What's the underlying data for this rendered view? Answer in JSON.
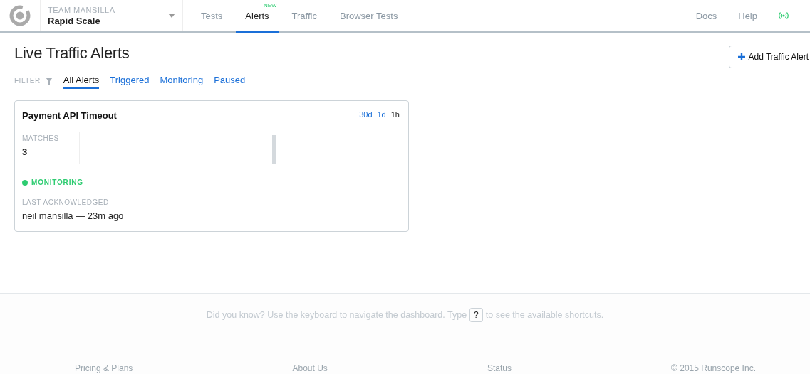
{
  "header": {
    "team": "TEAM MANSILLA",
    "project": "Rapid Scale",
    "nav": [
      {
        "label": "Tests",
        "selected": false
      },
      {
        "label": "Alerts",
        "selected": true,
        "badge": "NEW"
      },
      {
        "label": "Traffic",
        "selected": false
      },
      {
        "label": "Browser Tests",
        "selected": false
      }
    ],
    "links": [
      "Docs",
      "Help"
    ]
  },
  "page": {
    "title": "Live Traffic Alerts",
    "add_button": "Add Traffic Alert",
    "filter_label": "FILTER",
    "filters": [
      {
        "label": "All Alerts",
        "selected": true
      },
      {
        "label": "Triggered",
        "selected": false
      },
      {
        "label": "Monitoring",
        "selected": false
      },
      {
        "label": "Paused",
        "selected": false
      }
    ]
  },
  "alert_card": {
    "title": "Payment API Timeout",
    "ranges": [
      {
        "label": "30d",
        "selected": false
      },
      {
        "label": "1d",
        "selected": false
      },
      {
        "label": "1h",
        "selected": true
      }
    ],
    "matches_label": "MATCHES",
    "matches": "3",
    "status": {
      "text": "MONITORING",
      "color": "#2ecc71"
    },
    "ack_label": "LAST ACKNOWLEDGED",
    "ack": "neil mansilla — 23m ago"
  },
  "tip": {
    "before": "Did you know? Use the keyboard to navigate the dashboard. Type",
    "key": "?",
    "after": "to see the available shortcuts."
  },
  "footer": [
    "Pricing & Plans",
    "About Us",
    "Status",
    "© 2015 Runscope Inc."
  ]
}
